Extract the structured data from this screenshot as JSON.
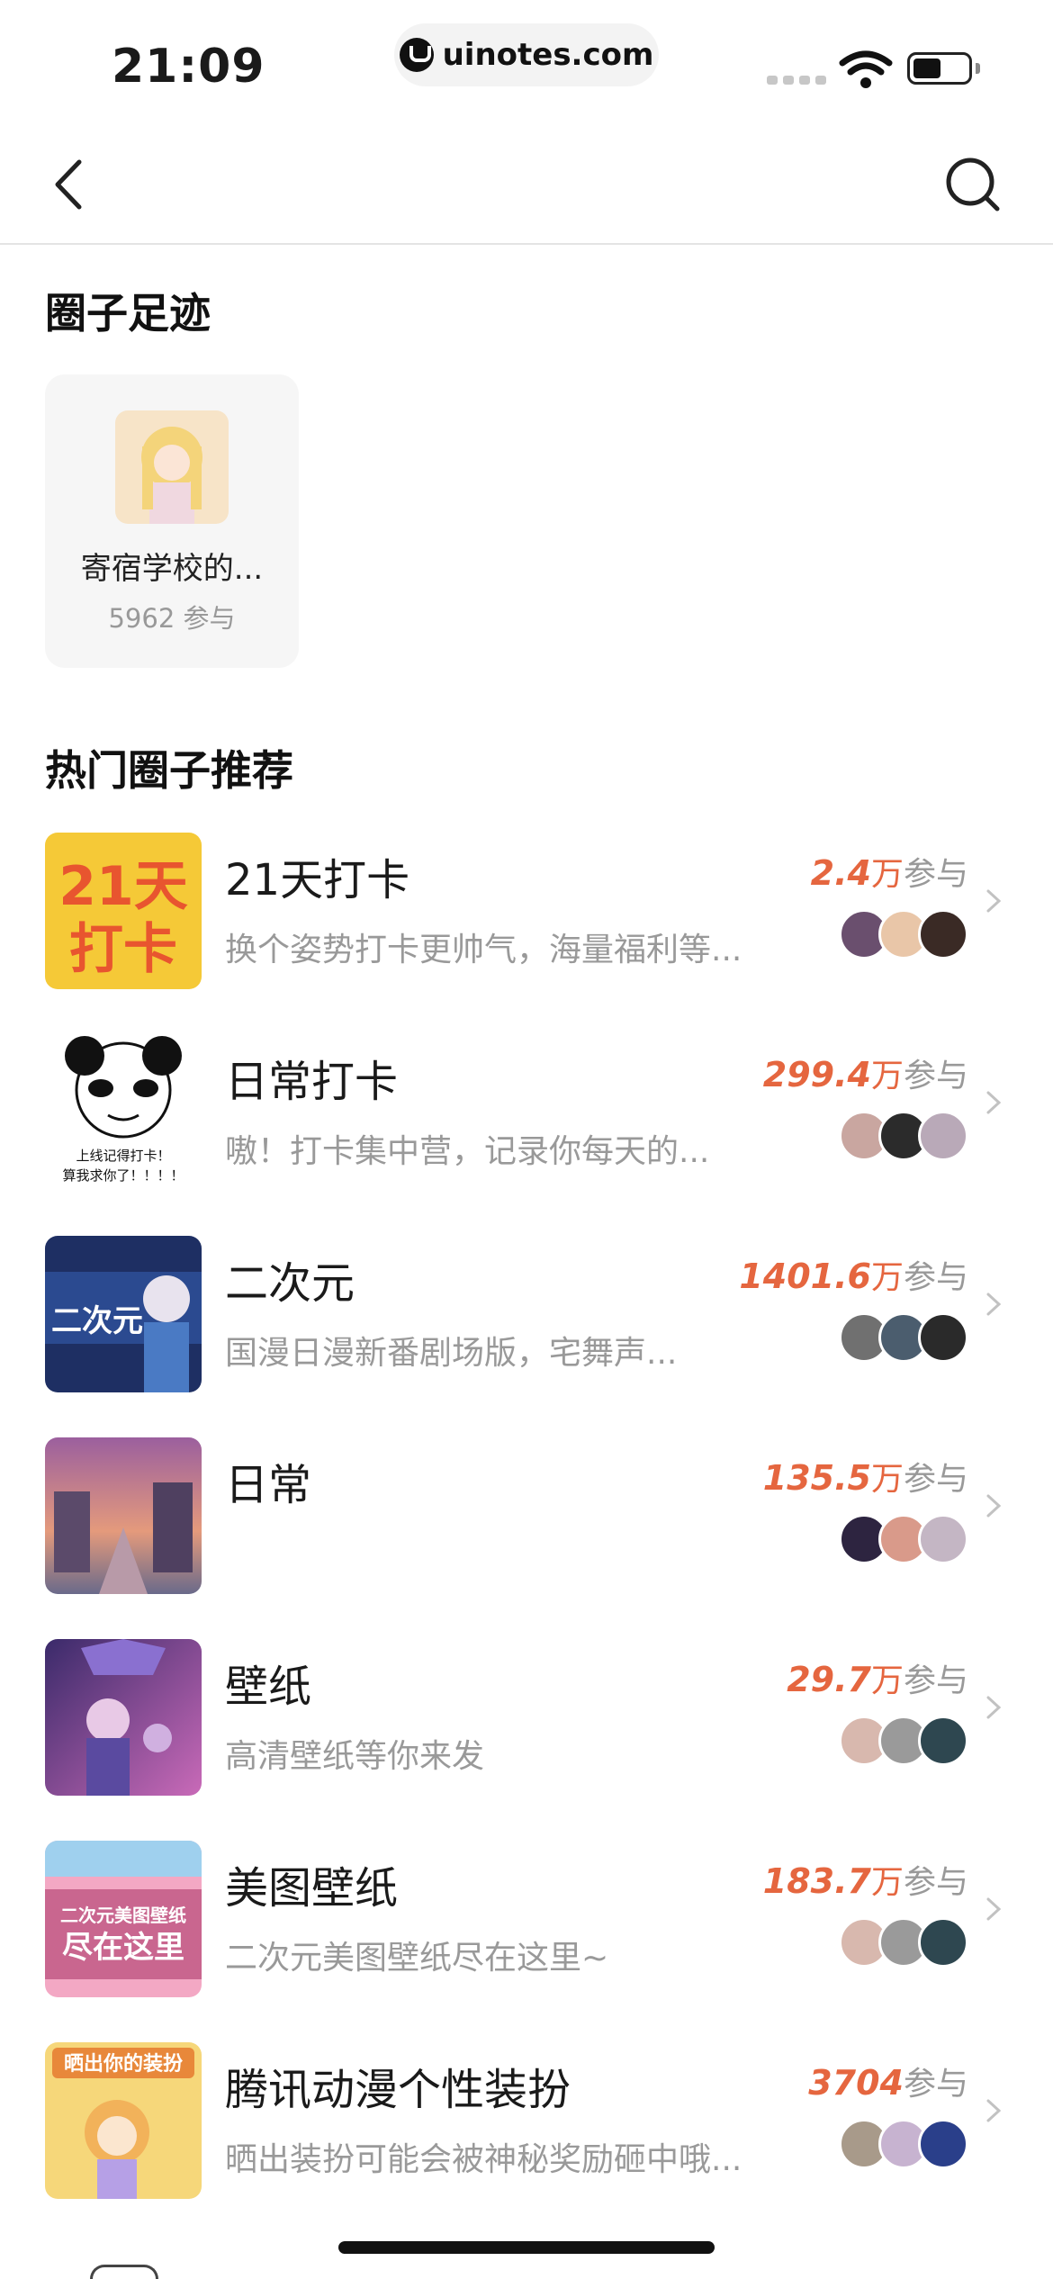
{
  "status_bar": {
    "time": "21:09",
    "url": "uinotes.com"
  },
  "sections": {
    "footprint_title": "圈子足迹",
    "hot_title": "热门圈子推荐"
  },
  "footprint": {
    "name": "寄宿学校的...",
    "count": "5962 参与"
  },
  "participate_suffix": "参与",
  "circles": [
    {
      "title": "21天打卡",
      "desc": "换个姿势打卡更帅气，海量福利等...",
      "count": "2.4",
      "unit": "万",
      "thumb_text": "21天打卡",
      "thumb_color": "#f5c937",
      "avatars": [
        "#6a4f6e",
        "#e9c6a8",
        "#3a2a25"
      ]
    },
    {
      "title": "日常打卡",
      "desc": "嗷！打卡集中营，记录你每天的...",
      "count": "299.4",
      "unit": "万",
      "thumb_text": "上线记得打卡！算我求你了！！！！",
      "thumb_color": "#ffffff",
      "avatars": [
        "#c9a6a0",
        "#2b2b2b",
        "#b9a9b8"
      ]
    },
    {
      "title": "二次元",
      "desc": "国漫日漫新番剧场版，宅舞声...",
      "count": "1401.6",
      "unit": "万",
      "thumb_text": "二次元",
      "thumb_color": "#1e2f63",
      "avatars": [
        "#707070",
        "#4b5d6e",
        "#2a2a2a"
      ]
    },
    {
      "title": "日常",
      "desc": "",
      "count": "135.5",
      "unit": "万",
      "thumb_text": "",
      "thumb_color": "#c58a9a",
      "avatars": [
        "#2d2440",
        "#d99a8a",
        "#c4b6c4"
      ]
    },
    {
      "title": "壁纸",
      "desc": "高清壁纸等你来发",
      "count": "29.7",
      "unit": "万",
      "thumb_text": "",
      "thumb_color": "#7a5bb0",
      "avatars": [
        "#d8b8ae",
        "#9a9a9a",
        "#2e4750"
      ]
    },
    {
      "title": "美图壁纸",
      "desc": "二次元美图壁纸尽在这里~",
      "count": "183.7",
      "unit": "万",
      "thumb_text": "二次元美图壁纸尽在这里",
      "thumb_color": "#f3a8c4",
      "avatars": [
        "#d8b8ae",
        "#9a9a9a",
        "#2e4750"
      ]
    },
    {
      "title": "腾讯动漫个性装扮",
      "desc": "晒出装扮可能会被神秘奖励砸中哦...",
      "count": "3704",
      "unit": "",
      "thumb_text": "晒出你的装扮",
      "thumb_color": "#f6d77a",
      "avatars": [
        "#a89a8a",
        "#c7b3d0",
        "#2a3f8a"
      ]
    }
  ],
  "colors": {
    "accent": "#e5663f",
    "muted": "#999999"
  }
}
